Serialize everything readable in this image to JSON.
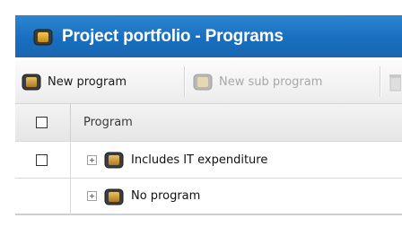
{
  "window": {
    "title": "Project portfolio - Programs",
    "icon": "program-folder-icon"
  },
  "toolbar": {
    "buttons": [
      {
        "label": "New program",
        "icon": "program-folder-icon",
        "enabled": true
      },
      {
        "label": "New sub program",
        "icon": "program-folder-icon",
        "enabled": false
      }
    ]
  },
  "grid": {
    "header": {
      "column_program": "Program"
    },
    "rows": [
      {
        "label": "Includes IT expenditure",
        "has_checkbox": true,
        "icon": "program-folder-icon"
      },
      {
        "label": "No program",
        "has_checkbox": false,
        "icon": "program-folder-icon"
      }
    ]
  },
  "colors": {
    "title_bar": "#1f72c2",
    "title_text": "#ffffff",
    "disabled_text": "#a8a8a8"
  }
}
